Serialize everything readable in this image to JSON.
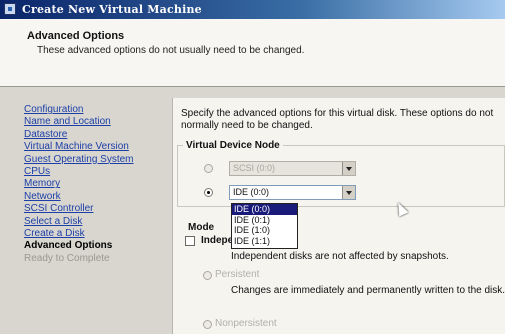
{
  "window": {
    "title": "Create New Virtual Machine"
  },
  "header": {
    "title": "Advanced Options",
    "subtitle": "These advanced options do not usually need to be changed."
  },
  "steps": [
    {
      "label": "Configuration",
      "state": "link"
    },
    {
      "label": "Name and Location",
      "state": "link"
    },
    {
      "label": "Datastore",
      "state": "link"
    },
    {
      "label": "Virtual Machine Version",
      "state": "link"
    },
    {
      "label": "Guest Operating System",
      "state": "link"
    },
    {
      "label": "CPUs",
      "state": "link"
    },
    {
      "label": "Memory",
      "state": "link"
    },
    {
      "label": "Network",
      "state": "link"
    },
    {
      "label": "SCSI Controller",
      "state": "link"
    },
    {
      "label": "Select a Disk",
      "state": "link"
    },
    {
      "label": "Create a Disk",
      "state": "link"
    },
    {
      "label": "Advanced Options",
      "state": "current"
    },
    {
      "label": "Ready to Complete",
      "state": "disabled"
    }
  ],
  "main": {
    "description": "Specify the advanced options for this virtual disk. These options do not normally need to be changed.",
    "virtual_device_node": {
      "title": "Virtual Device Node",
      "scsi_value": "SCSI (0:0)",
      "ide_value": "IDE (0:0)",
      "ide_options": [
        "IDE (0:0)",
        "IDE (0:1)",
        "IDE (1:0)",
        "IDE (1:1)"
      ],
      "ide_selected_index": 0
    },
    "mode": {
      "title": "Mode",
      "independent_label": "Independent",
      "independent_desc": "Independent disks are not affected by snapshots.",
      "persistent_label": "Persistent",
      "persistent_desc": "Changes are immediately and permanently written to the disk.",
      "nonpersistent_label": "Nonpersistent"
    }
  }
}
